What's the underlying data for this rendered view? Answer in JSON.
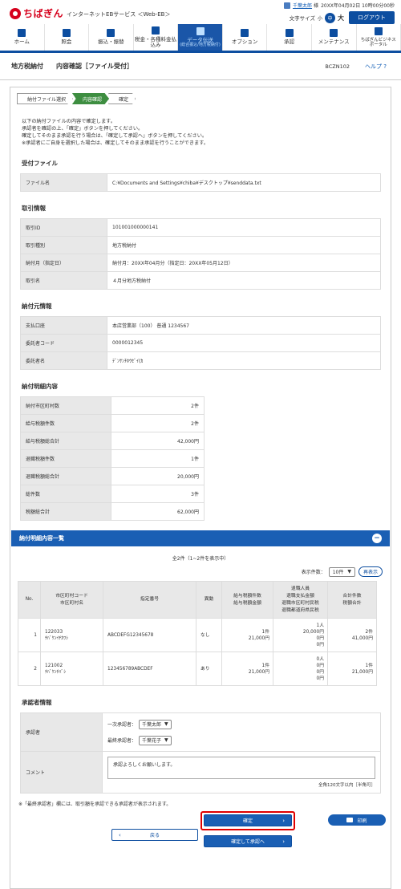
{
  "header": {
    "brand": "ちばぎん",
    "service": "インターネットEBサービス ＜Web-EB＞",
    "user_name": "千葉太郎",
    "user_suffix": "様",
    "last_login": "20XX年04月02日 10時00分00秒",
    "font_size_label": "文字サイズ",
    "font_small": "小",
    "font_mid": "中",
    "font_large": "大",
    "logout": "ログアウト"
  },
  "nav": [
    {
      "label": "ホーム",
      "icon": "home-icon"
    },
    {
      "label": "照会",
      "icon": "inquiry-icon"
    },
    {
      "label": "振込・振替",
      "icon": "transfer-icon"
    },
    {
      "label": "税金・各種料金払込み",
      "icon": "tax-icon"
    },
    {
      "label": "データ伝送",
      "sub": "(総合振込/地方税納付)",
      "icon": "data-transfer-icon"
    },
    {
      "label": "オプション",
      "icon": "option-icon"
    },
    {
      "label": "承認",
      "icon": "approve-icon"
    },
    {
      "label": "メンテナンス",
      "icon": "maintenance-icon"
    },
    {
      "label": "ちばぎんビジネスポータル",
      "icon": "portal-icon"
    }
  ],
  "title": {
    "category": "地方税納付",
    "screen": "内容確認［ファイル受付］",
    "code": "BCZN102",
    "help": "ヘルプ"
  },
  "steps": [
    "納付ファイル選択",
    "内容確認",
    "確定"
  ],
  "message": [
    "以下の納付ファイルの内容で確定します。",
    "承認者を確認の上、「確定」ボタンを押してください。",
    "確定してそのまま承認を行う場合は、「確定して承認へ」ボタンを押してください。",
    "※承認者にご自身を選択した場合は、確定してそのまま承認を行うことができます。"
  ],
  "file": {
    "title": "受付ファイル",
    "label": "ファイル名",
    "value": "C:¥Documents and Settings¥chiba¥デスクトップ¥senddata.txt"
  },
  "trans": {
    "title": "取引情報",
    "rows": [
      {
        "label": "取引ID",
        "value": "101001000000141"
      },
      {
        "label": "取引種別",
        "value": "地方税納付"
      },
      {
        "label": "納付月（指定日）",
        "value": "納付月：20XX年04月分（指定日：20XX年05月12日）"
      },
      {
        "label": "取引名",
        "value": "４月分地方税納付"
      }
    ]
  },
  "payer": {
    "title": "納付元情報",
    "rows": [
      {
        "label": "支払口座",
        "value": "本店営業部（100） 普通 1234567"
      },
      {
        "label": "委託者コード",
        "value": "0000012345"
      },
      {
        "label": "委託者名",
        "value": "ﾃﾞﾝｻﾝﾁﾎｳｾﾞｲ(ｶ"
      }
    ]
  },
  "detail": {
    "title": "納付明細内容",
    "rows": [
      {
        "label": "納付市区町村数",
        "value": "2件"
      },
      {
        "label": "給与税額件数",
        "value": "2件"
      },
      {
        "label": "給与税額総合計",
        "value": "42,000円"
      },
      {
        "label": "退職税額件数",
        "value": "1件"
      },
      {
        "label": "退職税額総合計",
        "value": "20,000円"
      },
      {
        "label": "総件数",
        "value": "3件"
      },
      {
        "label": "税額総合計",
        "value": "62,000円"
      }
    ]
  },
  "list": {
    "title": "納付明細内容一覧",
    "count": "全2件（1~2件を表示中）",
    "display_label": "表示件数：",
    "display_value": "10件",
    "redisplay": "再表示",
    "headers": [
      "No.",
      "市区町村コード\n市区町村名",
      "指定番号",
      "異動",
      "給与税額件数\n給与税額金額",
      "退職人員\n退職支払金額\n退職市区町村民税\n退職都道府県民税",
      "合計件数\n税額合計"
    ],
    "rows": [
      {
        "no": "1",
        "code": "122033",
        "name": "ﾁﾊﾞｹﾝｲﾁｶﾜｼ",
        "num": "ABCDEFG12345678",
        "change": "なし",
        "sal_cnt": "1件",
        "sal_amt": "21,000円",
        "ret": [
          "1人",
          "20,000円",
          "0円",
          "0円"
        ],
        "tot_cnt": "2件",
        "tot_amt": "41,000円"
      },
      {
        "no": "2",
        "code": "121002",
        "name": "ﾁﾊﾞｹﾝﾁﾊﾞｼ",
        "num": "123456789ABCDEF",
        "change": "あり",
        "sal_cnt": "1件",
        "sal_amt": "21,000円",
        "ret": [
          "0人",
          "0円",
          "0円",
          "0円"
        ],
        "tot_cnt": "1件",
        "tot_amt": "21,000円"
      }
    ]
  },
  "approver": {
    "title": "承認者情報",
    "label": "承認者",
    "first_label": "一次承認者：",
    "first_value": "千葉太郎",
    "final_label": "最終承認者：",
    "final_value": "千葉花子",
    "comment_label": "コメント",
    "comment_value": "承認よろしくお願いします。",
    "limit": "全角120文字以内［半角可］"
  },
  "footnote": "※「最終承認者」欄には、取引額を承認できる承認者が表示されます。",
  "buttons": {
    "back": "戻る",
    "confirm": "確定",
    "confirm_approve": "確定して承認へ",
    "print": "印刷"
  }
}
